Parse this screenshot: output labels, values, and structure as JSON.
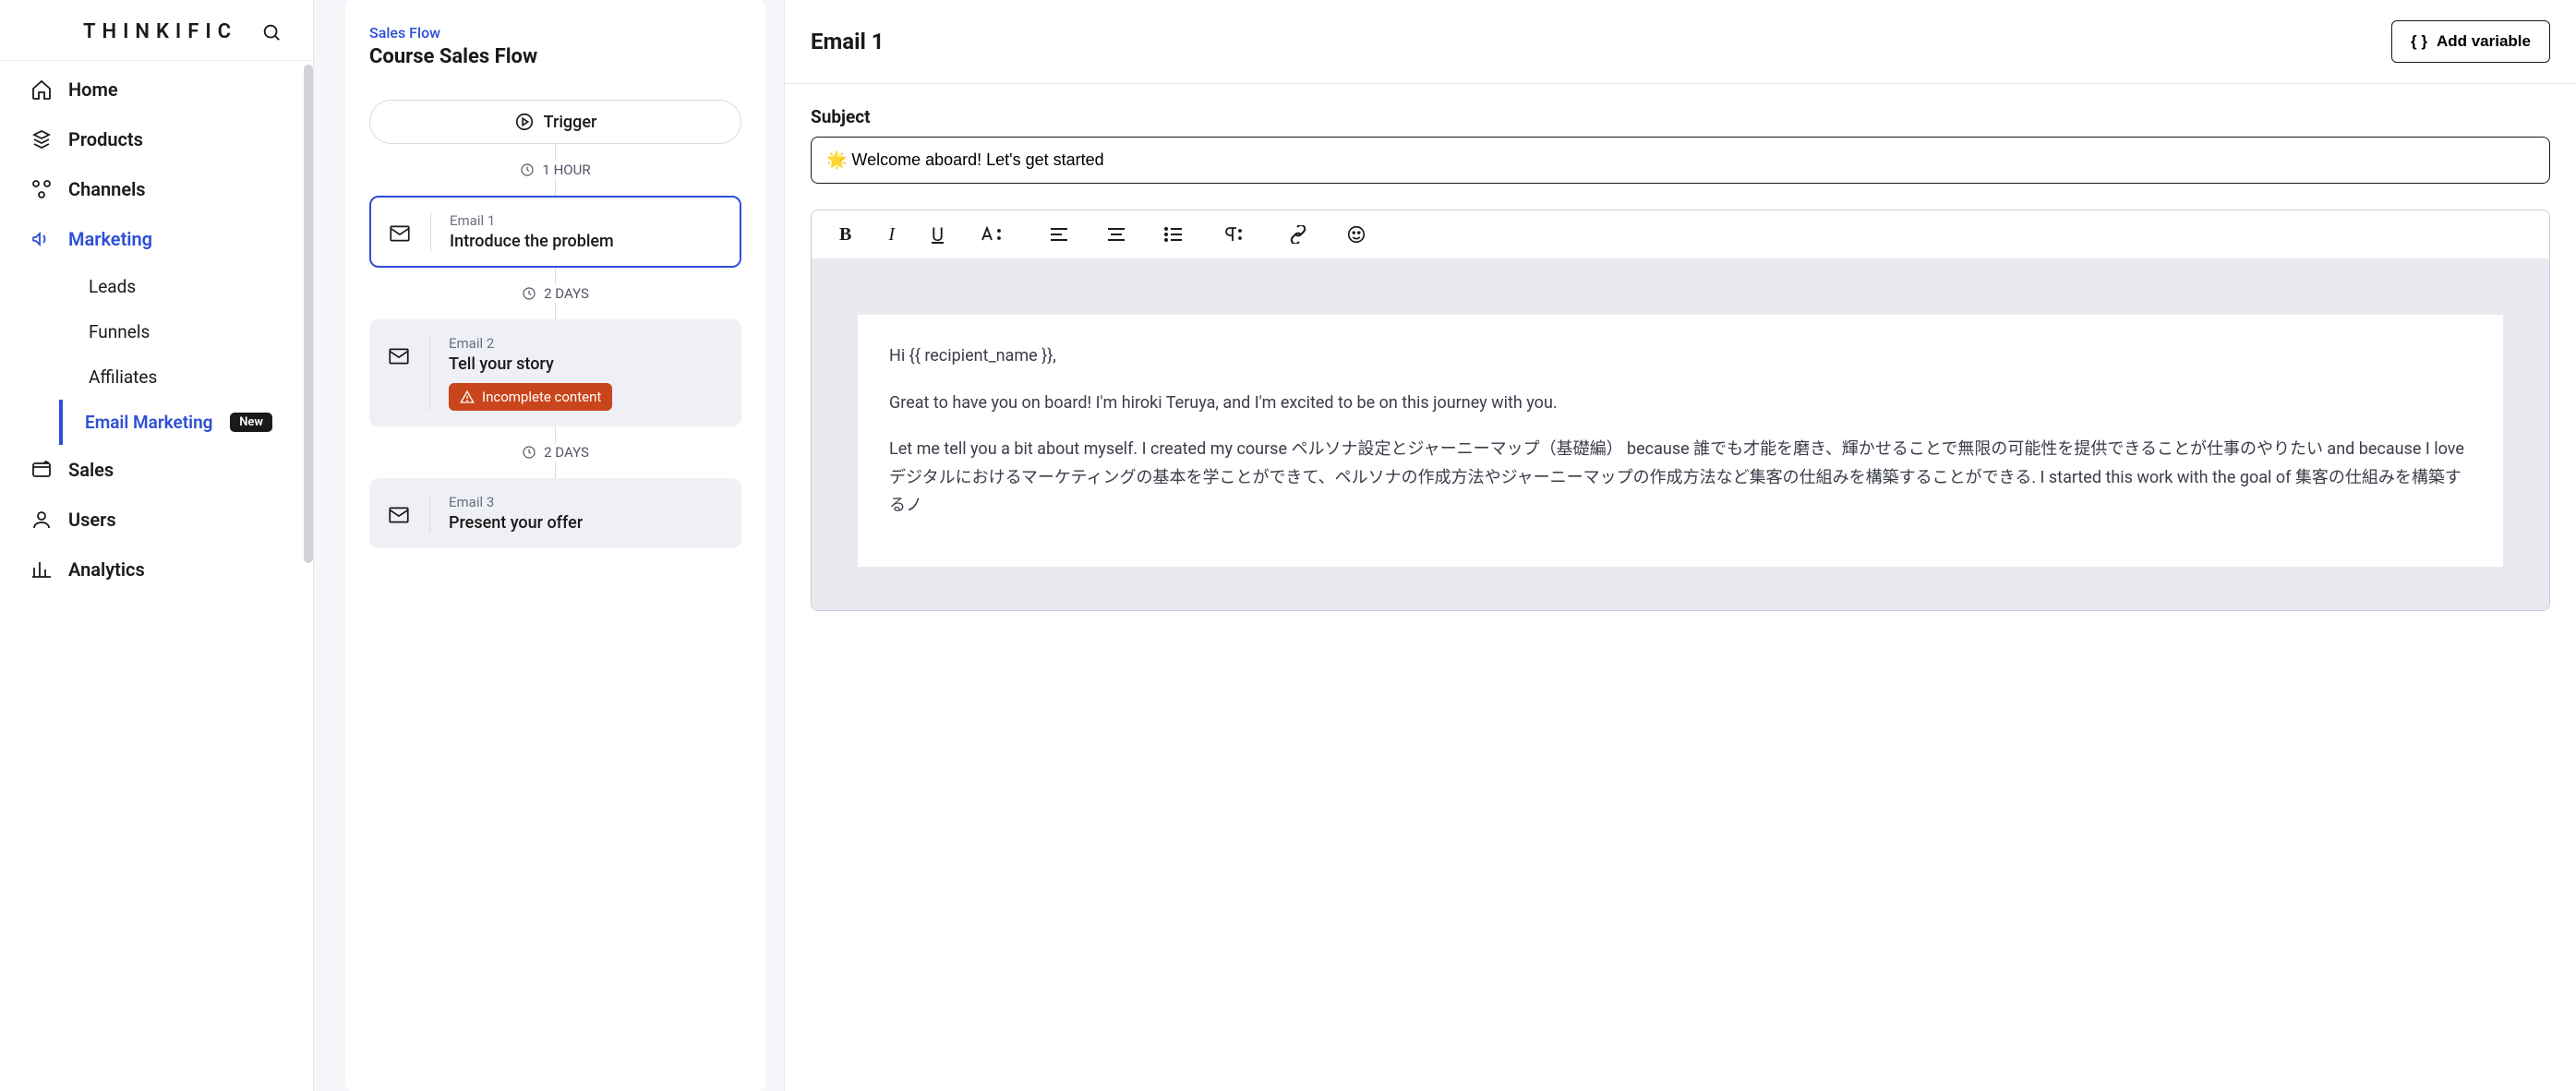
{
  "brand": {
    "name": "THINKIFIC"
  },
  "sidebar": {
    "items": [
      {
        "label": "Home"
      },
      {
        "label": "Products"
      },
      {
        "label": "Channels"
      },
      {
        "label": "Marketing"
      },
      {
        "label": "Sales"
      },
      {
        "label": "Users"
      },
      {
        "label": "Analytics"
      }
    ],
    "marketing_sub": [
      {
        "label": "Leads"
      },
      {
        "label": "Funnels"
      },
      {
        "label": "Affiliates"
      },
      {
        "label": "Email Marketing",
        "badge": "New"
      }
    ]
  },
  "flow": {
    "breadcrumb": "Sales Flow",
    "title": "Course Sales Flow",
    "trigger": "Trigger",
    "delays": [
      "1 HOUR",
      "2 DAYS",
      "2 DAYS"
    ],
    "emails": [
      {
        "eyebrow": "Email 1",
        "title": "Introduce the problem"
      },
      {
        "eyebrow": "Email 2",
        "title": "Tell your story",
        "warning": "Incomplete content"
      },
      {
        "eyebrow": "Email 3",
        "title": "Present your offer"
      }
    ]
  },
  "editor": {
    "heading": "Email 1",
    "add_variable": "Add variable",
    "subject_label": "Subject",
    "subject_value": "🌟 Welcome aboard! Let's get started",
    "content": {
      "greeting": "Hi {{ recipient_name }},",
      "p1": "Great to have you on board! I'm hiroki Teruya, and I'm excited to be on this journey with you.",
      "p2": "Let me tell you a bit about myself. I created my course ペルソナ設定とジャーニーマップ（基礎編） because 誰でも才能を磨き、輝かせることで無限の可能性を提供できることが仕事のやりたい and because I love デジタルにおけるマーケティングの基本を学ことができて、ペルソナの作成方法やジャーニーマップの作成方法など集客の仕組みを構築することができる. I started this work with the goal of 集客の仕組みを構築するノ"
    }
  }
}
